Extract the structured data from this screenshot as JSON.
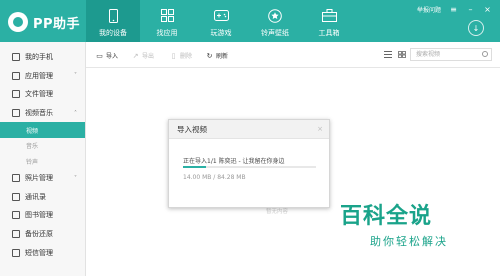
{
  "app": {
    "logo_text": "PP助手"
  },
  "nav": [
    {
      "label": "我的设备",
      "icon": "phone-icon",
      "active": true
    },
    {
      "label": "找应用",
      "icon": "grid-icon",
      "active": false
    },
    {
      "label": "玩游戏",
      "icon": "gamepad-icon",
      "active": false
    },
    {
      "label": "铃声壁纸",
      "icon": "star-icon",
      "active": false
    },
    {
      "label": "工具箱",
      "icon": "toolbox-icon",
      "active": false
    }
  ],
  "topbar": {
    "feedback_label": "举报问题"
  },
  "sidebar": {
    "items": [
      {
        "label": "我的手机",
        "icon": "phone-icon"
      },
      {
        "label": "应用管理",
        "icon": "apps-icon",
        "arrow": "˅"
      },
      {
        "label": "文件管理",
        "icon": "folder-icon"
      },
      {
        "label": "视频音乐",
        "icon": "video-icon",
        "arrow": "˄"
      }
    ],
    "subitems": [
      {
        "label": "视频",
        "active": true
      },
      {
        "label": "音乐",
        "active": false
      },
      {
        "label": "铃声",
        "active": false
      }
    ],
    "items2": [
      {
        "label": "照片管理",
        "icon": "photo-icon",
        "arrow": "˅"
      },
      {
        "label": "通讯录",
        "icon": "contacts-icon"
      },
      {
        "label": "图书管理",
        "icon": "book-icon"
      },
      {
        "label": "备份还原",
        "icon": "backup-icon"
      },
      {
        "label": "短信管理",
        "icon": "sms-icon"
      }
    ]
  },
  "toolbar": {
    "import_label": "导入",
    "export_label": "导出",
    "delete_label": "删除",
    "refresh_label": "刷新",
    "search_placeholder": "搜索视频"
  },
  "content": {
    "empty_hint": "暂无内容"
  },
  "dialog": {
    "title": "导入视频",
    "status": "正在导入1/1   陈奕迅 - 让我留在你身边",
    "size": "14.00 MB / 84.28 MB",
    "progress": 0.17
  },
  "watermark": {
    "title": "百科全说",
    "subtitle": "助你轻松解决"
  }
}
